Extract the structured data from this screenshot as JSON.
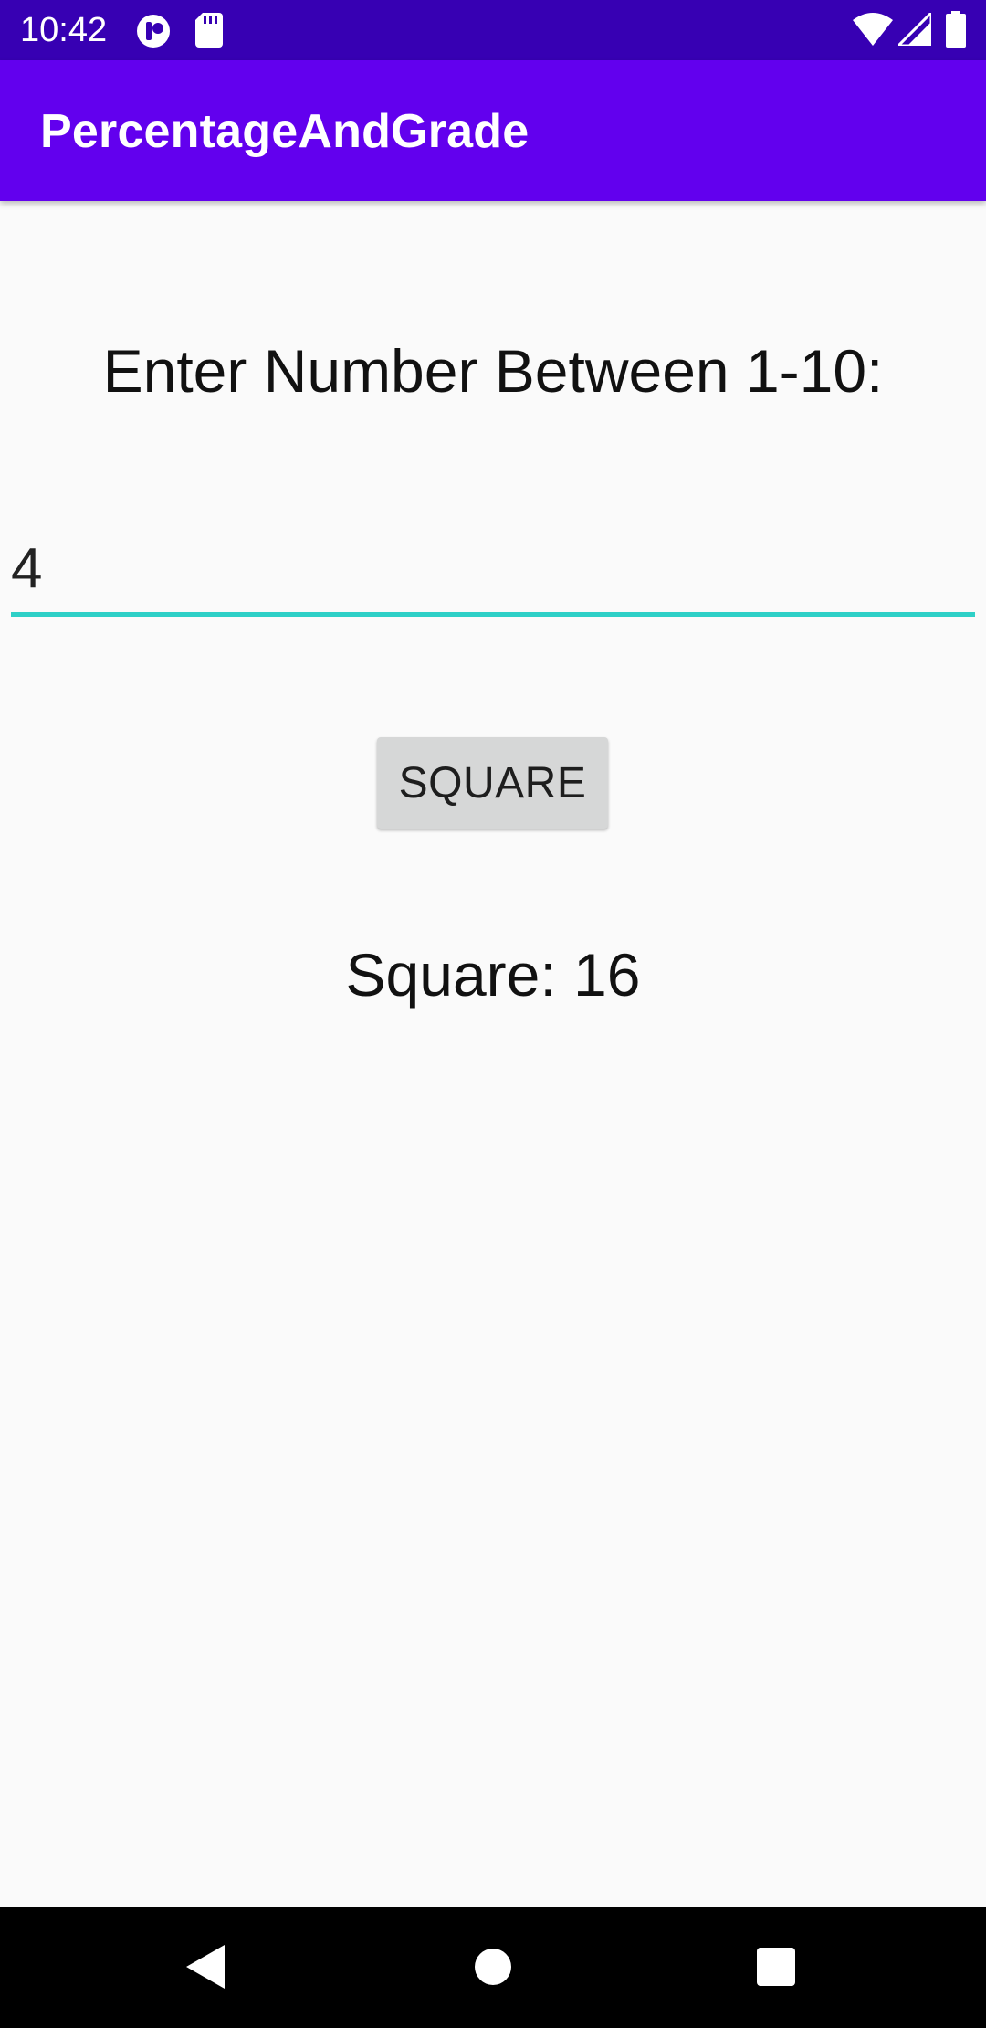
{
  "status_bar": {
    "time": "10:42",
    "icons": [
      "app-notification-icon",
      "sd-card-icon",
      "wifi-icon",
      "cellular-signal-icon",
      "battery-icon"
    ]
  },
  "app_bar": {
    "title": "PercentageAndGrade",
    "color": "#6200ee",
    "status_color": "#3700b3"
  },
  "main": {
    "prompt": "Enter Number Between 1-10:",
    "input_value": "4",
    "button_label": "SQUARE",
    "result": "Square: 16",
    "accent_color": "#2ed0c7"
  },
  "nav_bar": {
    "icons": [
      "back-icon",
      "home-icon",
      "recents-icon"
    ]
  }
}
